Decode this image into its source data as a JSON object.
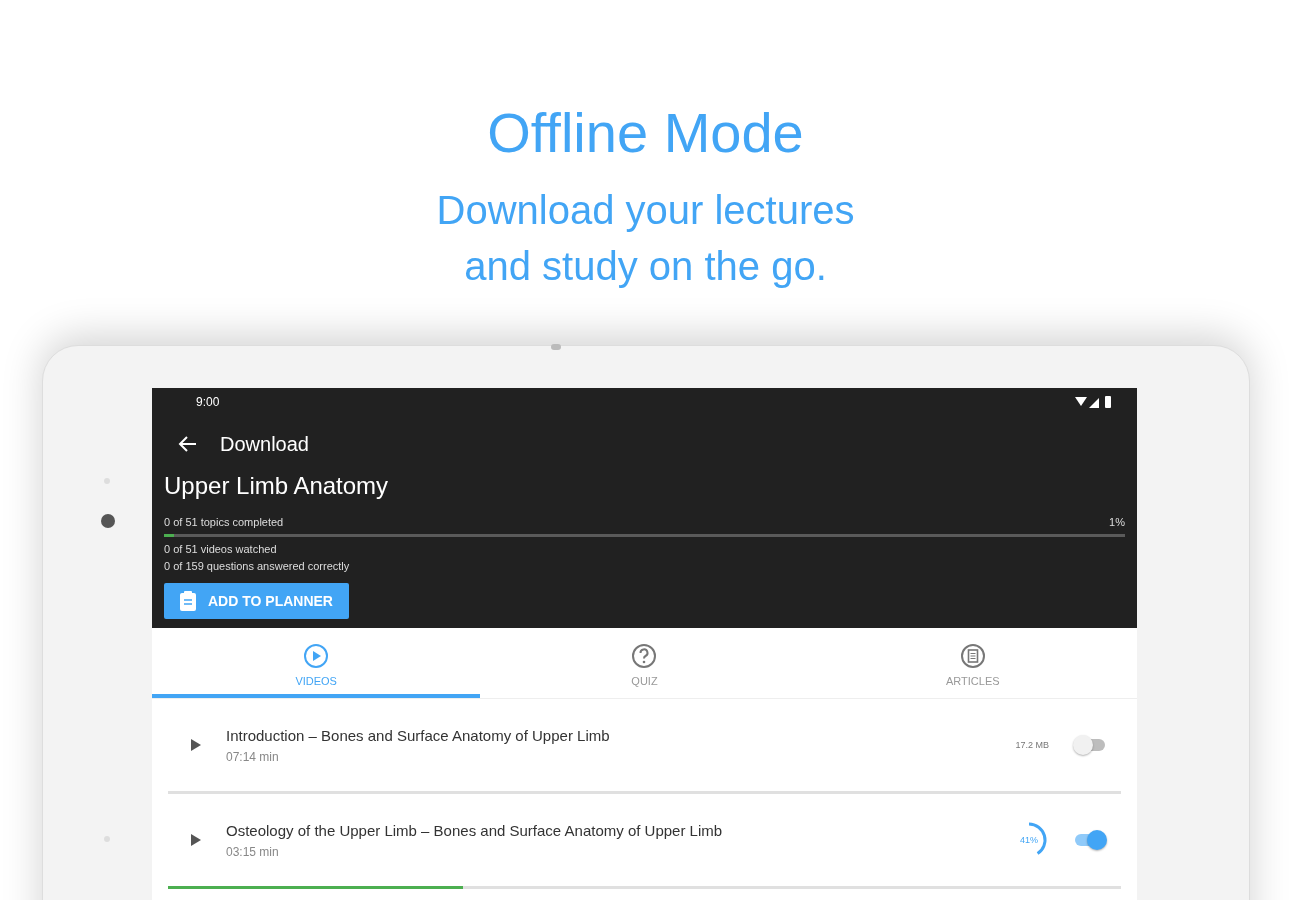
{
  "promo": {
    "title": "Offline Mode",
    "subtitle": "Download your lectures\nand study on the go."
  },
  "status_bar": {
    "time": "9:00"
  },
  "app_bar": {
    "title": "Download"
  },
  "course": {
    "title": "Upper Limb Anatomy",
    "topics": "0 of 51 topics completed",
    "level": 0.01,
    "reading": "1%",
    "videos": "0 of 51 videos watched",
    "questions": "0 of 159 questions answered correctly",
    "button": "ADD TO PLANNER"
  },
  "tabs": [
    {
      "label": "VIDEOS",
      "kind": "play",
      "selected": true
    },
    {
      "label": "QUIZ",
      "kind": "question",
      "selected": false
    },
    {
      "label": "ARTICLES",
      "kind": "article",
      "selected": false
    }
  ],
  "videos": [
    {
      "title": "Introduction – Bones and Surface Anatomy of Upper Limb",
      "duration": "07:14 min",
      "kind": "size",
      "size": "17.2 MB",
      "on": false
    },
    {
      "title": "Osteology of the Upper Limb – Bones and Surface Anatomy of Upper Limb",
      "duration": "03:15 min",
      "kind": "progress",
      "download": {
        "reading": "41%",
        "level": 0.41
      },
      "on": true,
      "level": 0.31
    }
  ]
}
